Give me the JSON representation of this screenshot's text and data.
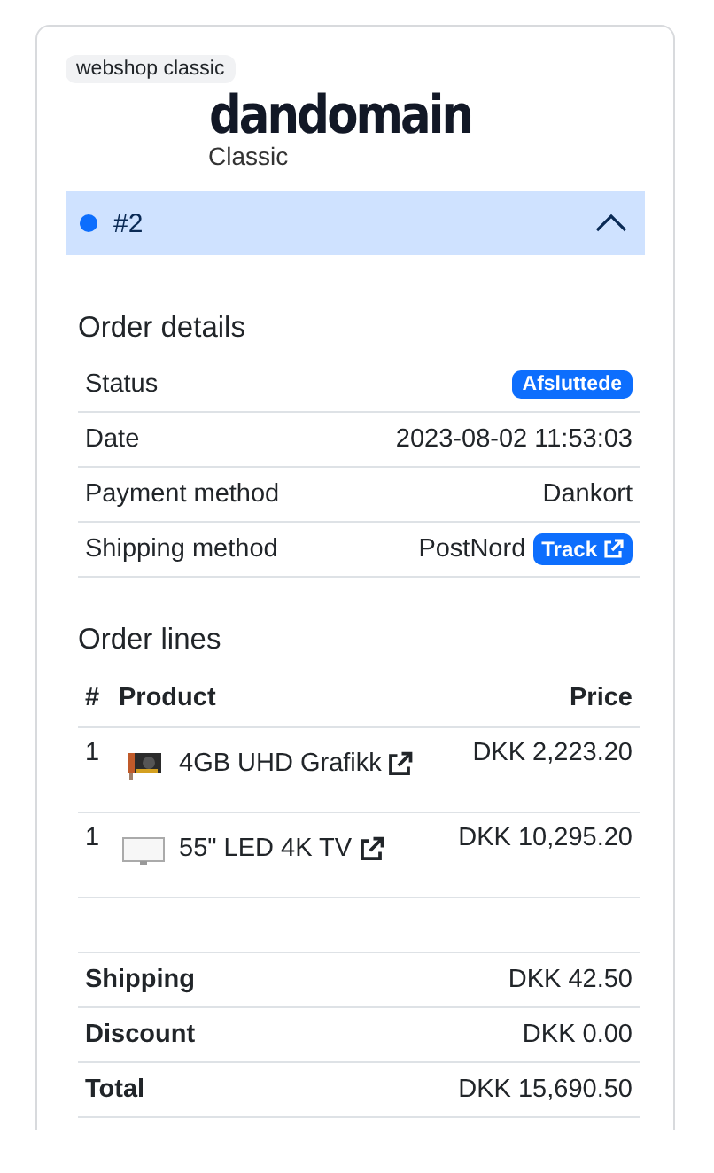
{
  "badge": "webshop classic",
  "logo": {
    "name": "dandomain",
    "sub": "Classic"
  },
  "order": {
    "number": "#2",
    "color": "#0d6efd",
    "expanded": true
  },
  "details": {
    "title": "Order details",
    "rows": [
      {
        "label": "Status",
        "kind": "badge",
        "value": "Afsluttede"
      },
      {
        "label": "Date",
        "kind": "text",
        "value": "2023-08-02 11:53:03"
      },
      {
        "label": "Payment method",
        "kind": "text",
        "value": "Dankort"
      },
      {
        "label": "Shipping method",
        "kind": "track",
        "value": "PostNord",
        "link": "Track"
      }
    ]
  },
  "lines": {
    "title": "Order lines",
    "columns": [
      "#",
      "Product",
      "Price"
    ],
    "rows": [
      {
        "qty": "1",
        "product": "4GB UHD Grafikk",
        "price": "DKK 2,223.20"
      },
      {
        "qty": "1",
        "product": "55\" LED 4K TV",
        "price": "DKK 10,295.20"
      }
    ]
  },
  "totals": [
    {
      "label": "Shipping",
      "value": "DKK 42.50"
    },
    {
      "label": "Discount",
      "value": "DKK 0.00"
    },
    {
      "label": "Total",
      "value": "DKK 15,690.50"
    }
  ]
}
